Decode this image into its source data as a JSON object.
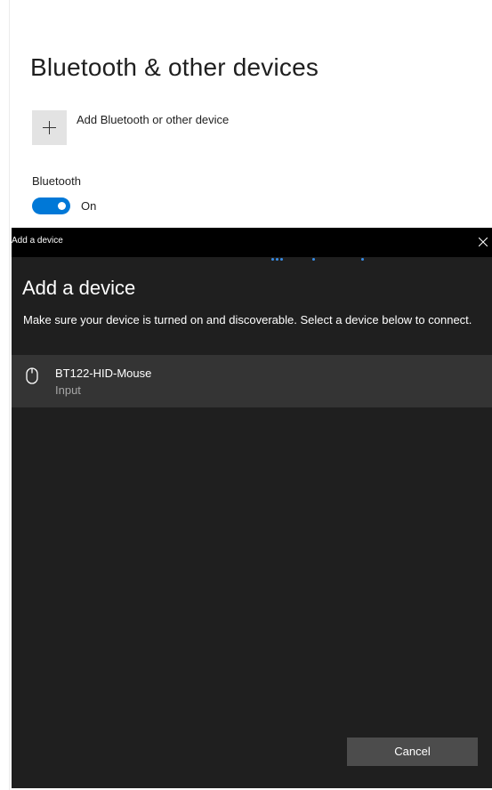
{
  "settings": {
    "title": "Bluetooth & other devices",
    "add_device_label": "Add Bluetooth or other device",
    "bluetooth_label": "Bluetooth",
    "bluetooth_state": "On",
    "bluetooth_enabled": true,
    "accent_color": "#0078d7"
  },
  "dialog": {
    "window_title": "Add a device",
    "heading": "Add a device",
    "description": "Make sure your device is turned on and discoverable. Select a device below to connect.",
    "progress_state": "searching",
    "devices": [
      {
        "name": "BT122-HID-Mouse",
        "type": "Input",
        "icon": "mouse-icon"
      }
    ],
    "cancel_label": "Cancel",
    "background_color": "#1f1f1f",
    "titlebar_color": "#000000"
  }
}
